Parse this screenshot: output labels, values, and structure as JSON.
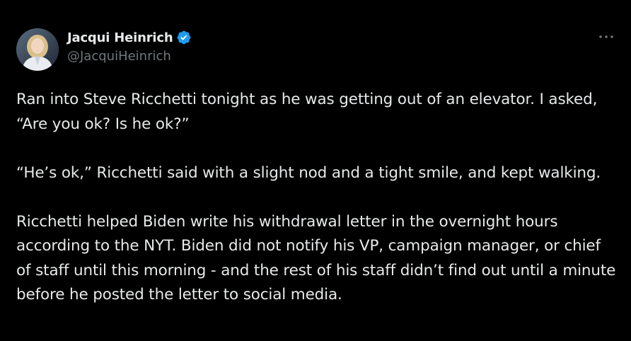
{
  "tweet": {
    "author": {
      "display_name": "Jacqui Heinrich",
      "handle": "@JacquiHeinrich",
      "verified": true,
      "verified_color": "#1d9bf0"
    },
    "more_icon": "more-horizontal-icon",
    "paragraphs": [
      "Ran into Steve Ricchetti tonight as he was getting out of an elevator. I asked, “Are you ok? Is he ok?”",
      "“He’s ok,” Ricchetti said with a slight nod and a tight smile, and kept walking.",
      "Ricchetti helped Biden write his withdrawal letter in the overnight hours according to the NYT. Biden did not notify his VP, campaign manager, or chief of staff until this morning - and the rest of his staff didn’t find out until a minute before he posted the letter to social media."
    ]
  },
  "colors": {
    "background": "#000000",
    "text_primary": "#e7e9ea",
    "text_secondary": "#71767b",
    "accent": "#1d9bf0"
  }
}
